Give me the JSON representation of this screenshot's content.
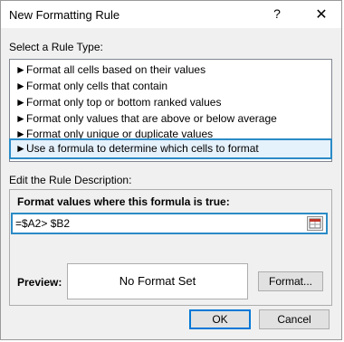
{
  "dialog": {
    "title": "New Formatting Rule",
    "help": "?",
    "close": "✕"
  },
  "rule_type": {
    "label": "Select a Rule Type:",
    "items": [
      {
        "label": "Format all cells based on their values"
      },
      {
        "label": "Format only cells that contain"
      },
      {
        "label": "Format only top or bottom ranked values"
      },
      {
        "label": "Format only values that are above or below average"
      },
      {
        "label": "Format only unique or duplicate values"
      },
      {
        "label": "Use a formula to determine which cells to format",
        "selected": true
      }
    ],
    "arrow": "►"
  },
  "description": {
    "label": "Edit the Rule Description:",
    "formula_label": "Format values where this formula is true:",
    "formula_value": "=$A2> $B2"
  },
  "preview": {
    "label": "Preview:",
    "text": "No Format Set"
  },
  "buttons": {
    "format": "Format...",
    "ok": "OK",
    "cancel": "Cancel"
  },
  "colors": {
    "highlight": "#2b8bc6",
    "ok_border": "#0078d7"
  }
}
